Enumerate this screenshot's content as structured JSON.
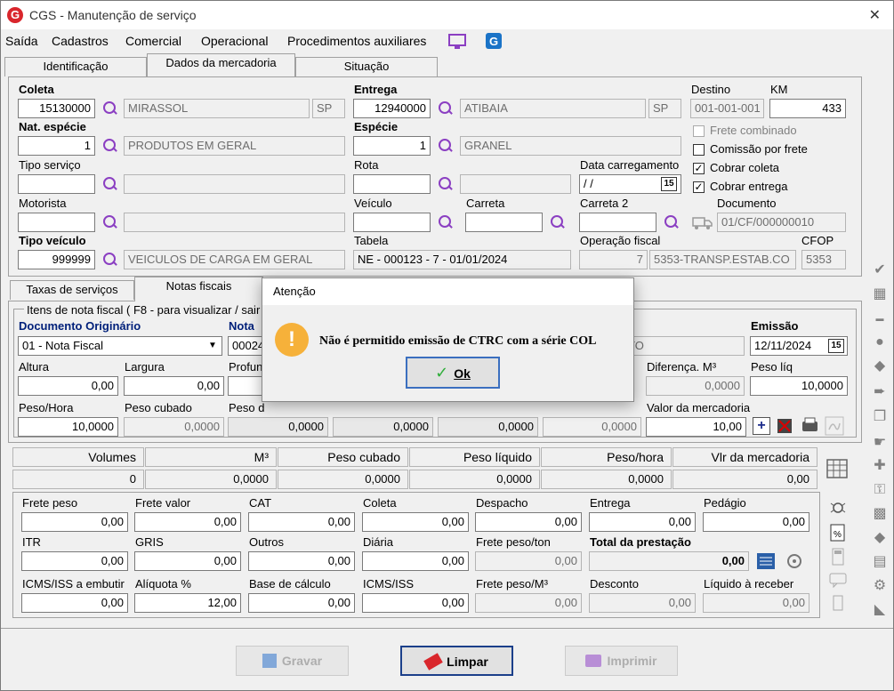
{
  "window": {
    "title": "CGS - Manutenção de serviço",
    "icon_letter": "G",
    "close": "✕"
  },
  "menu": [
    "Saída",
    "Cadastros",
    "Comercial",
    "Operacional",
    "Procedimentos auxiliares"
  ],
  "tabs": [
    "Identificação",
    "Dados da mercadoria",
    "Situação"
  ],
  "form": {
    "coleta": {
      "label": "Coleta",
      "code": "15130000",
      "city": "MIRASSOL",
      "uf": "SP"
    },
    "entrega": {
      "label": "Entrega",
      "code": "12940000",
      "city": "ATIBAIA",
      "uf": "SP"
    },
    "destino": {
      "label": "Destino",
      "value": "001-001-001"
    },
    "km": {
      "label": "KM",
      "value": "433"
    },
    "nat_especie": {
      "label": "Nat. espécie",
      "code": "1",
      "desc": "PRODUTOS EM GERAL"
    },
    "especie": {
      "label": "Espécie",
      "code": "1",
      "desc": "GRANEL"
    },
    "frete_combinado": "Frete combinado",
    "comissao_frete": "Comissão por frete",
    "cobrar_coleta": "Cobrar coleta",
    "cobrar_entrega": "Cobrar entrega",
    "check_mark": "✓",
    "tipo_servico": {
      "label": "Tipo serviço"
    },
    "rota": {
      "label": "Rota"
    },
    "data_carregamento": {
      "label": "Data carregamento",
      "value": "/ /",
      "cal": "15"
    },
    "motorista": {
      "label": "Motorista"
    },
    "veiculo": {
      "label": "Veículo"
    },
    "carreta": {
      "label": "Carreta"
    },
    "carreta2": {
      "label": "Carreta 2"
    },
    "documento": {
      "label": "Documento",
      "value": "01/CF/000000010"
    },
    "tipo_veiculo": {
      "label": "Tipo veículo",
      "code": "999999",
      "desc": "VEICULOS DE CARGA EM GERAL"
    },
    "tabela": {
      "label": "Tabela",
      "value": "NE - 000123 - 7 - 01/01/2024"
    },
    "operacao_fiscal": {
      "label": "Operação fiscal",
      "code": "7",
      "desc": "5353-TRANSP.ESTAB.CO"
    },
    "cfop": {
      "label": "CFOP",
      "value": "5353"
    }
  },
  "subtabs": [
    "Taxas de serviços",
    "Notas fiscais"
  ],
  "notas": {
    "group_title": "Itens de nota fiscal ( F8 - para visualizar / sair",
    "doc_originario": {
      "label": "Documento Originário",
      "value": "01 - Nota Fiscal"
    },
    "nota_label": "Nota",
    "nota_value": "00024",
    "text_partial": "TO",
    "emissao": {
      "label": "Emissão",
      "value": "12/11/2024",
      "cal": "15"
    },
    "altura": {
      "label": "Altura",
      "value": "0,00"
    },
    "largura": {
      "label": "Largura",
      "value": "0,00"
    },
    "profundidade_label": "Profun",
    "diferenca": {
      "label": "Diferença. M³",
      "value": "0,0000"
    },
    "peso_liq": {
      "label": "Peso líq",
      "value": "10,0000"
    },
    "peso_hora": {
      "label": "Peso/Hora",
      "value": "10,0000"
    },
    "peso_cubado": {
      "label": "Peso cubado",
      "value": "0,0000"
    },
    "peso_label_partial": "Peso d",
    "v1": "0,0000",
    "v2": "0,0000",
    "v3": "0,0000",
    "v4": "0,0000",
    "valor_mercadoria": {
      "label": "Valor da mercadoria",
      "value": "10,00"
    }
  },
  "totals": {
    "headers": [
      "Volumes",
      "M³",
      "Peso cubado",
      "Peso líquido",
      "Peso/hora",
      "Vlr da mercadoria"
    ],
    "values": [
      "0",
      "0,0000",
      "0,0000",
      "0,0000",
      "0,0000",
      "0,00"
    ]
  },
  "frete": {
    "row1": [
      {
        "label": "Frete peso",
        "value": "0,00"
      },
      {
        "label": "Frete valor",
        "value": "0,00"
      },
      {
        "label": "CAT",
        "value": "0,00"
      },
      {
        "label": "Coleta",
        "value": "0,00"
      },
      {
        "label": "Despacho",
        "value": "0,00"
      },
      {
        "label": "Entrega",
        "value": "0,00"
      },
      {
        "label": "Pedágio",
        "value": "0,00"
      }
    ],
    "row2": [
      {
        "label": "ITR",
        "value": "0,00"
      },
      {
        "label": "GRIS",
        "value": "0,00"
      },
      {
        "label": "Outros",
        "value": "0,00"
      },
      {
        "label": "Diária",
        "value": "0,00"
      },
      {
        "label": "Frete peso/ton",
        "value": "0,00"
      },
      {
        "label": "Total da prestação",
        "value": "0,00"
      }
    ],
    "row3": [
      {
        "label": "ICMS/ISS a embutir",
        "value": "0,00"
      },
      {
        "label": "Alíquota %",
        "value": "12,00"
      },
      {
        "label": "Base de cálculo",
        "value": "0,00"
      },
      {
        "label": "ICMS/ISS",
        "value": "0,00"
      },
      {
        "label": "Frete peso/M³",
        "value": "0,00"
      },
      {
        "label": "Desconto",
        "value": "0,00"
      },
      {
        "label": "Líquido à receber",
        "value": "0,00"
      }
    ]
  },
  "buttons": {
    "gravar": "Gravar",
    "limpar": "Limpar",
    "imprimir": "Imprimir"
  },
  "dialog": {
    "title": "Atenção",
    "message": "Não é permitido emissão de CTRC com a série COL",
    "ok": "Ok",
    "icon": "!",
    "ok_icon": "✓"
  },
  "colors": {
    "accent": "#8b3fc2",
    "warn": "#f6b13a",
    "brand_red": "#d9262c",
    "ok_border": "#3b6fbf"
  }
}
